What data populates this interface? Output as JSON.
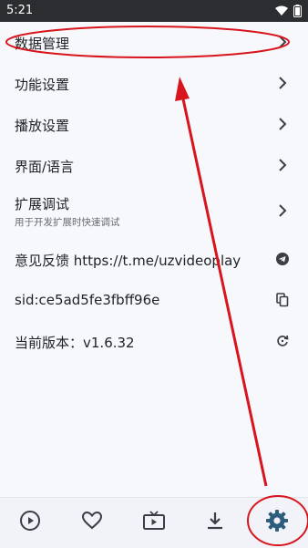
{
  "status_bar": {
    "time": "5:21"
  },
  "settings": [
    {
      "label": "数据管理",
      "trailing_icon": "chevron-right-icon"
    },
    {
      "label": "功能设置",
      "trailing_icon": "chevron-right-icon"
    },
    {
      "label": "播放设置",
      "trailing_icon": "chevron-right-icon"
    },
    {
      "label": "界面/语言",
      "trailing_icon": "chevron-right-icon"
    },
    {
      "label": "扩展调试",
      "subtitle": "用于开发扩展时快速调试",
      "trailing_icon": "chevron-right-icon"
    },
    {
      "label": "意见反馈 https://t.me/uzvideoplay",
      "trailing_icon": "telegram-icon"
    },
    {
      "label": "sid:ce5ad5fe3fbff96e",
      "trailing_icon": "copy-icon"
    },
    {
      "label": "当前版本：v1.6.32",
      "trailing_icon": "refresh-icon"
    }
  ],
  "bottom_nav": [
    {
      "icon": "play-circle-icon"
    },
    {
      "icon": "heart-icon"
    },
    {
      "icon": "tv-icon"
    },
    {
      "icon": "download-icon"
    },
    {
      "icon": "gear-icon",
      "selected": true
    }
  ],
  "colors": {
    "annotation": "#d8141c",
    "nav_active": "#2f5d7c",
    "nav_inactive": "#3b3e44",
    "background": "#f7f8fc"
  }
}
